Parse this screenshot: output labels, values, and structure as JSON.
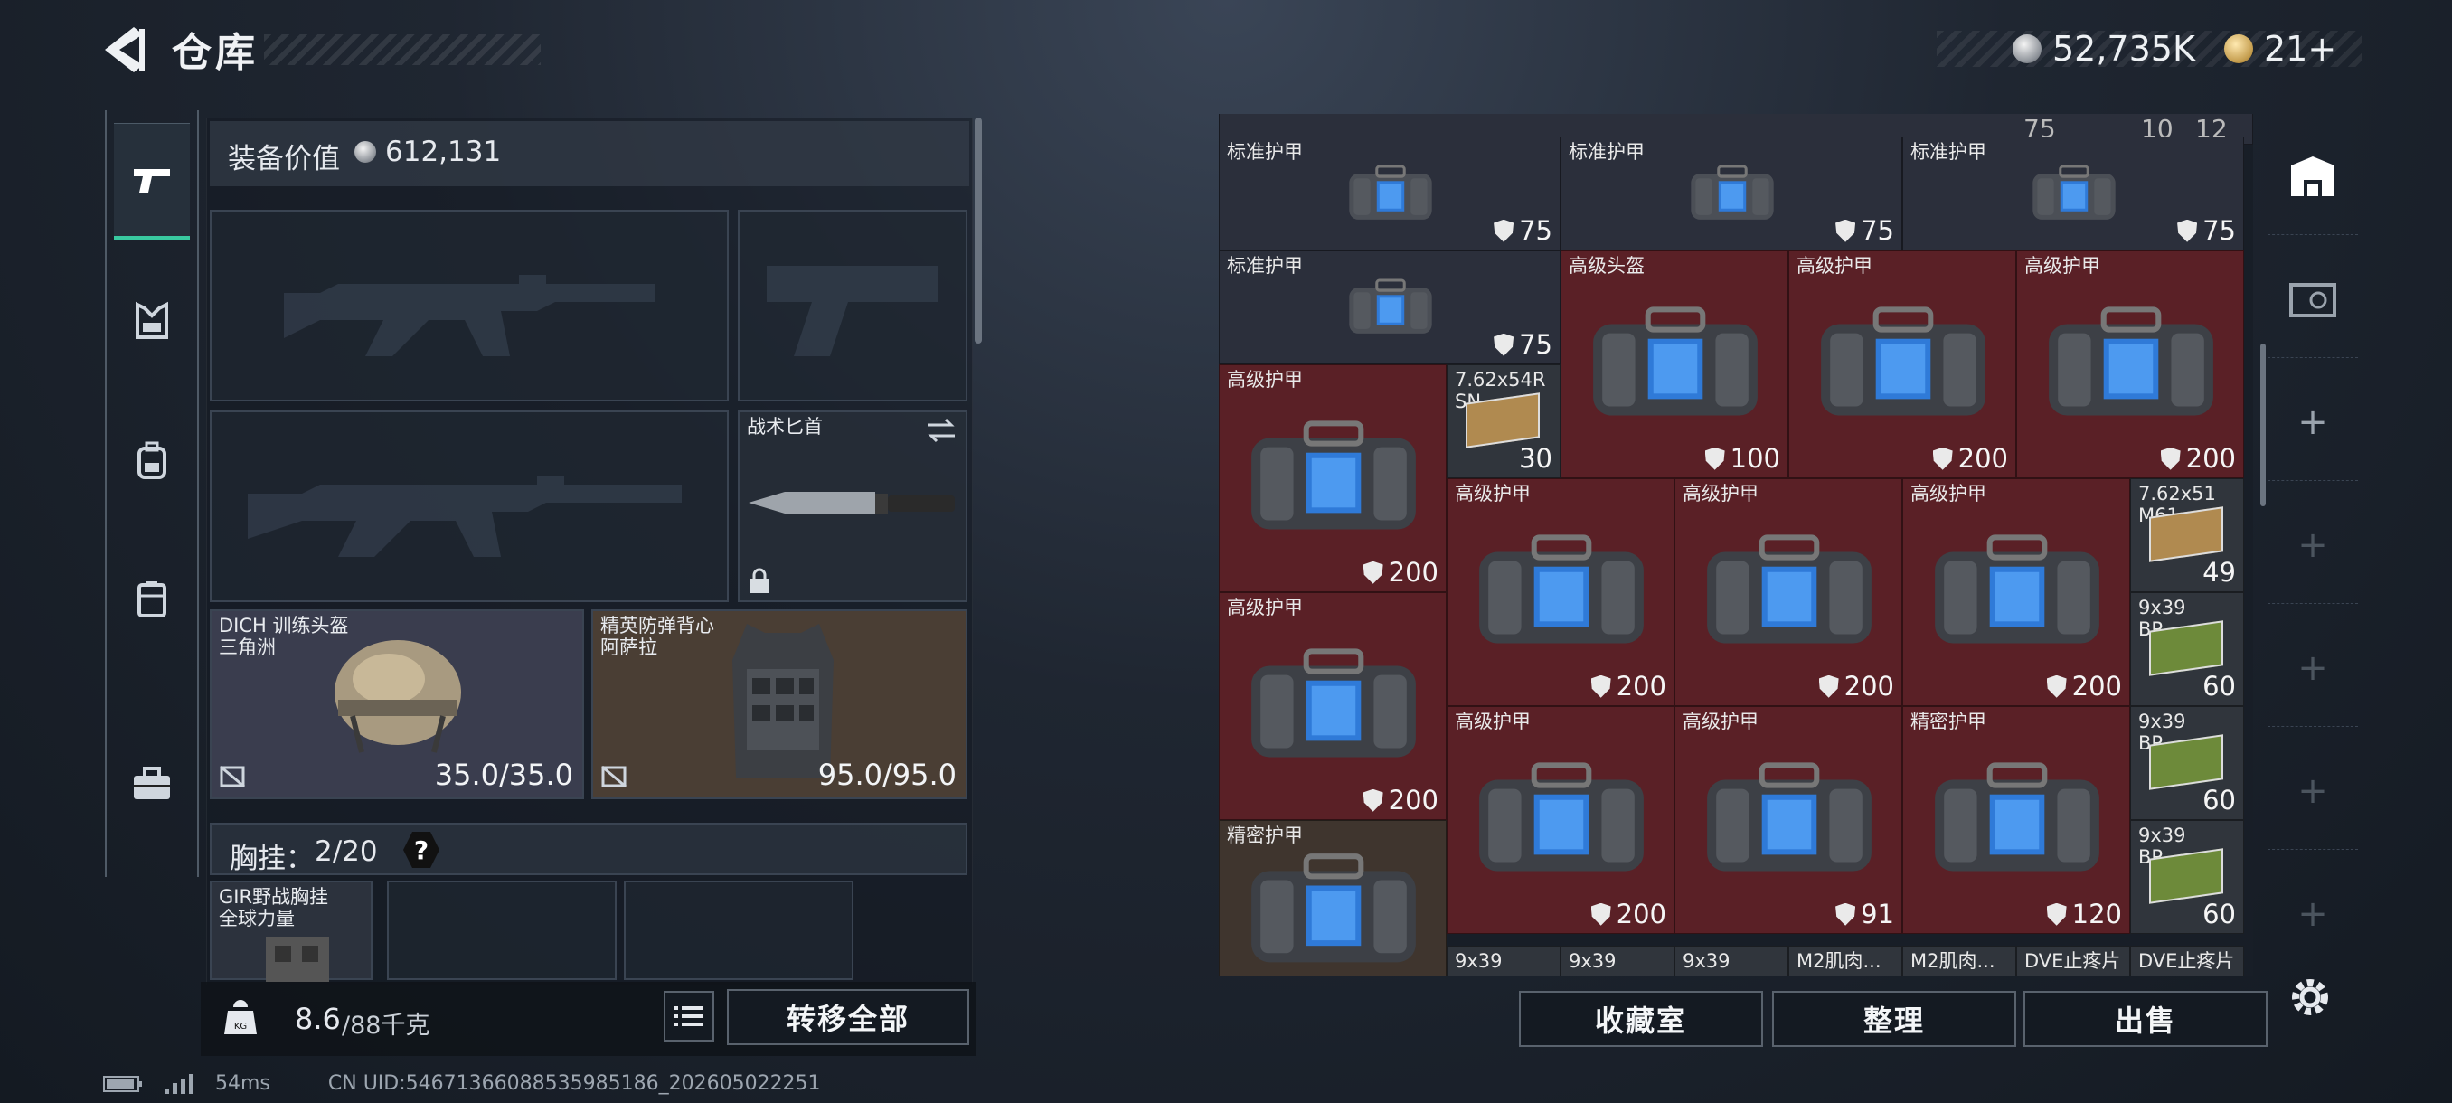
{
  "header": {
    "title": "仓库",
    "silver": "52,735K",
    "gold": "21+"
  },
  "left": {
    "value_label": "装备价值",
    "value": "612,131",
    "knife": {
      "label": "战术匕首"
    },
    "helmet": {
      "name": "DICH 训练头盔",
      "sub": "三角洲",
      "durability": "35.0/35.0"
    },
    "vest": {
      "name": "精英防弹背心",
      "sub": "阿萨拉",
      "durability": "95.0/95.0"
    },
    "chest_label": "胸挂：",
    "chest_count": "2/20",
    "chest_help": "?",
    "rig": {
      "name": "GIR野战胸挂",
      "sub": "全球力量"
    },
    "weight": "8.6",
    "weight_max": "/88千克",
    "transfer_all": "转移全部"
  },
  "grid": {
    "top_partial": [
      "75",
      "10",
      "12"
    ],
    "items": [
      {
        "name": "标准护甲",
        "dur": "75",
        "kind": "std"
      },
      {
        "name": "标准护甲",
        "dur": "75",
        "kind": "std"
      },
      {
        "name": "标准护甲",
        "dur": "75",
        "kind": "std"
      },
      {
        "name": "标准护甲",
        "dur": "75",
        "kind": "std"
      },
      {
        "name": "高级头盔",
        "dur": "100",
        "kind": "red"
      },
      {
        "name": "高级护甲",
        "dur": "200",
        "kind": "red"
      },
      {
        "name": "高级护甲",
        "dur": "200",
        "kind": "red"
      },
      {
        "name": "高级护甲",
        "dur": "200",
        "kind": "red"
      },
      {
        "name": "高级护甲",
        "dur": "200",
        "kind": "red"
      },
      {
        "name": "高级护甲",
        "dur": "200",
        "kind": "red"
      },
      {
        "name": "高级护甲",
        "dur": "200",
        "kind": "red"
      },
      {
        "name": "高级护甲",
        "dur": "200",
        "kind": "red"
      },
      {
        "name": "高级护甲",
        "dur": "200",
        "kind": "red"
      },
      {
        "name": "高级护甲",
        "dur": "200",
        "kind": "red"
      },
      {
        "name": "高级护甲",
        "dur": "91",
        "kind": "red"
      },
      {
        "name": "精密护甲",
        "dur": "120",
        "kind": "red"
      },
      {
        "name": "精密护甲",
        "dur": "",
        "kind": "tan"
      }
    ],
    "ammo": [
      {
        "name": "7.62x54R",
        "sub": "SN",
        "count": "30"
      },
      {
        "name": "7.62x51",
        "sub": "M61",
        "count": "49"
      },
      {
        "name": "9x39",
        "sub": "BP",
        "count": "60"
      },
      {
        "name": "9x39",
        "sub": "BP",
        "count": "60"
      },
      {
        "name": "9x39",
        "sub": "BP",
        "count": "60"
      }
    ],
    "bottom_partial": [
      "9x39",
      "9x39",
      "9x39",
      "M2肌肉...",
      "M2肌肉...",
      "DVE止疼片",
      "DVE止疼片"
    ]
  },
  "actions": {
    "collection": "收藏室",
    "organize": "整理",
    "sell": "出售"
  },
  "status": {
    "ping": "54ms",
    "uid": "CN UID:546713660885359851​86_202605022251"
  }
}
